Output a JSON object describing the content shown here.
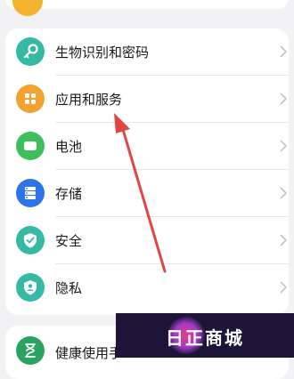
{
  "colors": {
    "accent": "#e24545",
    "biometrics_icon": "#35b8a4",
    "apps_icon": "#f2a22e",
    "battery_icon": "#3fbf5c",
    "storage_icon": "#2e74e6",
    "security_icon": "#35b8a4",
    "privacy_icon": "#35b8a4",
    "health_icon": "#29a35f"
  },
  "settings": {
    "items": [
      {
        "label": "生物识别和密码",
        "icon": "key-icon"
      },
      {
        "label": "应用和服务",
        "icon": "apps-grid-icon"
      },
      {
        "label": "电池",
        "icon": "battery-icon"
      },
      {
        "label": "存储",
        "icon": "storage-icon"
      },
      {
        "label": "安全",
        "icon": "shield-icon"
      },
      {
        "label": "隐私",
        "icon": "privacy-icon"
      }
    ],
    "partial_item": {
      "label": "健康使用手",
      "icon": "hourglass-icon"
    }
  },
  "watermark": {
    "text": "日正商城"
  }
}
